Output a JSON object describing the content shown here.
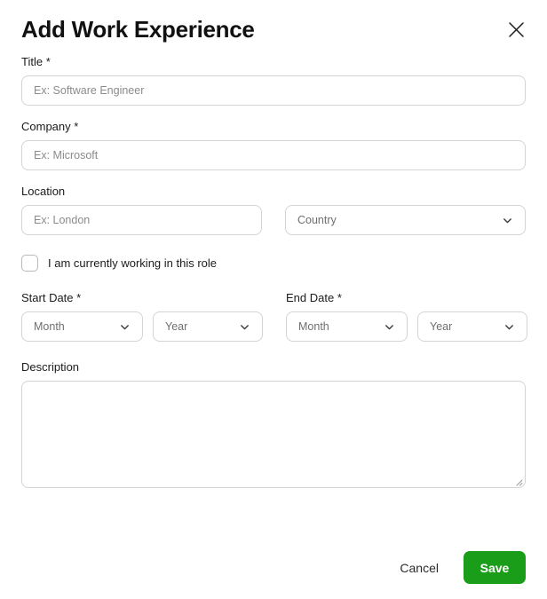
{
  "dialog": {
    "title": "Add Work Experience",
    "close_icon": "close-icon"
  },
  "fields": {
    "title": {
      "label": "Title *",
      "placeholder": "Ex: Software Engineer",
      "value": ""
    },
    "company": {
      "label": "Company *",
      "placeholder": "Ex: Microsoft",
      "value": ""
    },
    "location": {
      "label": "Location",
      "city_placeholder": "Ex: London",
      "city_value": "",
      "country_value": "Country",
      "country_icon": "chevron-down-icon"
    },
    "currently_working": {
      "label": "I am currently working in this role",
      "checked": false
    },
    "start_date": {
      "label": "Start Date *",
      "month_value": "Month",
      "year_value": "Year"
    },
    "end_date": {
      "label": "End Date *",
      "month_value": "Month",
      "year_value": "Year"
    },
    "description": {
      "label": "Description",
      "placeholder": "",
      "value": ""
    }
  },
  "footer": {
    "cancel_label": "Cancel",
    "save_label": "Save",
    "save_color": "#1a9e1a"
  }
}
